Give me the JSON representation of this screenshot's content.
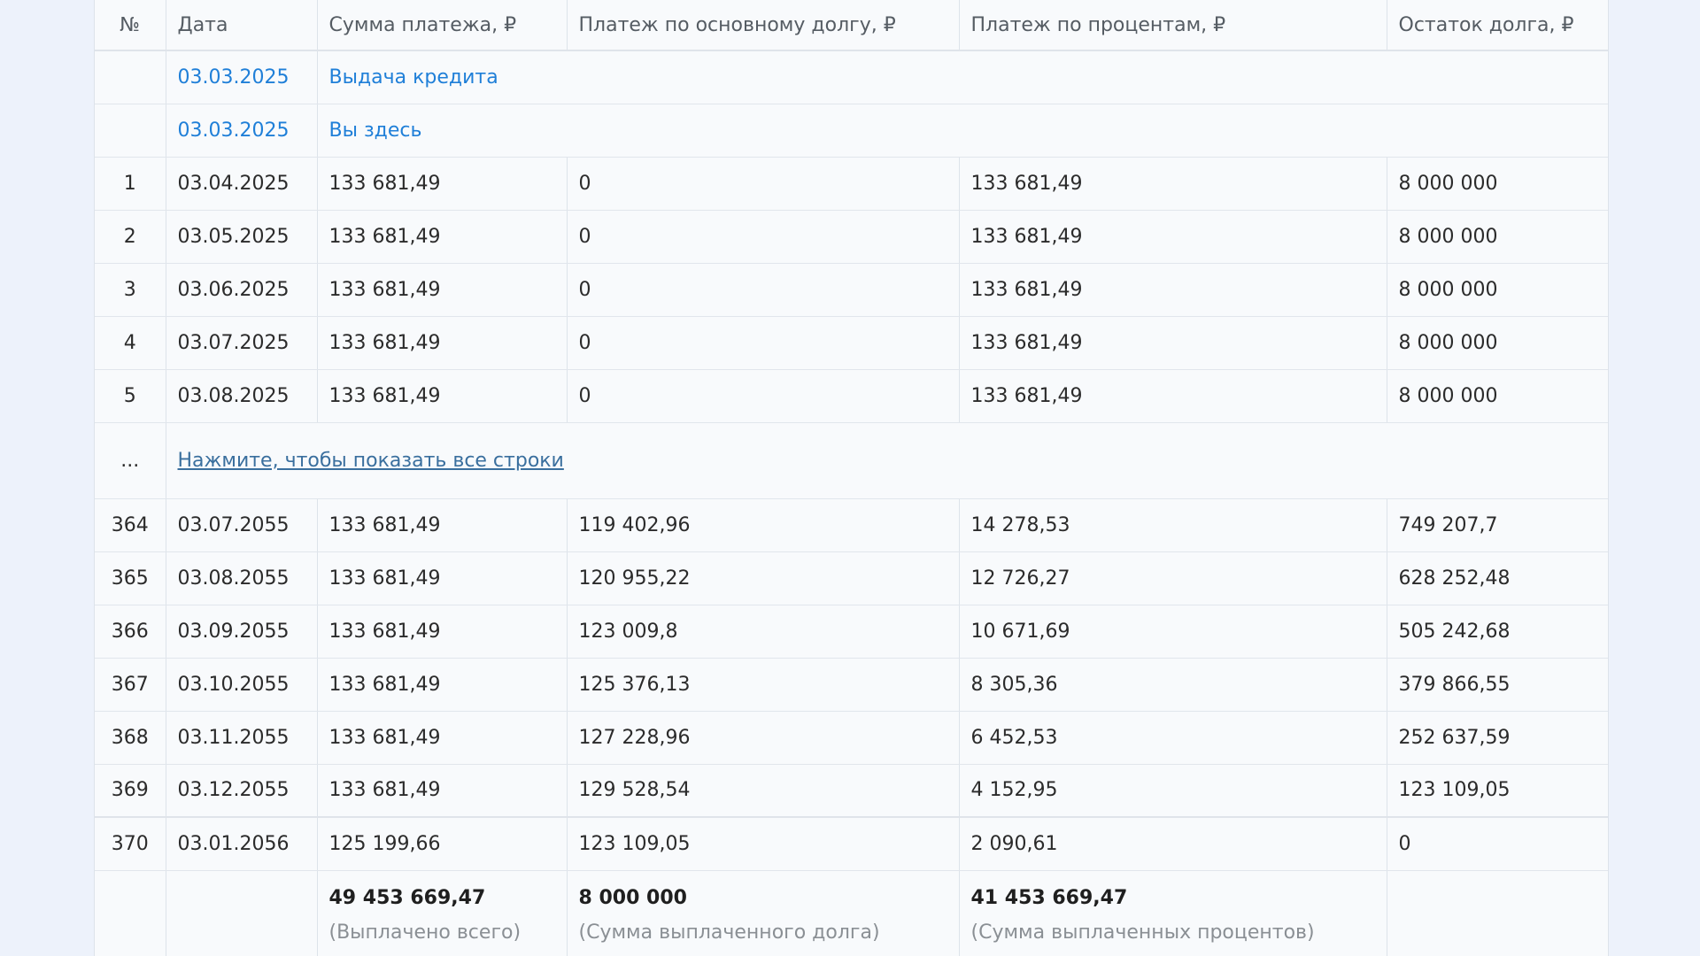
{
  "headers": [
    "№",
    "Дата",
    "Сумма платежа, ₽",
    "Платеж по основному долгу, ₽",
    "Платеж по процентам, ₽",
    "Остаток долга, ₽"
  ],
  "events": [
    {
      "date": "03.03.2025",
      "label": "Выдача кредита"
    },
    {
      "date": "03.03.2025",
      "label": "Вы здесь"
    }
  ],
  "rows_top": [
    [
      "1",
      "03.04.2025",
      "133 681,49",
      "0",
      "133 681,49",
      "8 000 000"
    ],
    [
      "2",
      "03.05.2025",
      "133 681,49",
      "0",
      "133 681,49",
      "8 000 000"
    ],
    [
      "3",
      "03.06.2025",
      "133 681,49",
      "0",
      "133 681,49",
      "8 000 000"
    ],
    [
      "4",
      "03.07.2025",
      "133 681,49",
      "0",
      "133 681,49",
      "8 000 000"
    ],
    [
      "5",
      "03.08.2025",
      "133 681,49",
      "0",
      "133 681,49",
      "8 000 000"
    ]
  ],
  "show_more": {
    "ellipsis": "...",
    "label": "Нажмите, чтобы показать все строки"
  },
  "rows_bottom": [
    [
      "364",
      "03.07.2055",
      "133 681,49",
      "119 402,96",
      "14 278,53",
      "749 207,7"
    ],
    [
      "365",
      "03.08.2055",
      "133 681,49",
      "120 955,22",
      "12 726,27",
      "628 252,48"
    ],
    [
      "366",
      "03.09.2055",
      "133 681,49",
      "123 009,8",
      "10 671,69",
      "505 242,68"
    ],
    [
      "367",
      "03.10.2055",
      "133 681,49",
      "125 376,13",
      "8 305,36",
      "379 866,55"
    ],
    [
      "368",
      "03.11.2055",
      "133 681,49",
      "127 228,96",
      "6 452,53",
      "252 637,59"
    ],
    [
      "369",
      "03.12.2055",
      "133 681,49",
      "129 528,54",
      "4 152,95",
      "123 109,05"
    ],
    [
      "370",
      "03.01.2056",
      "125 199,66",
      "123 109,05",
      "2 090,61",
      "0"
    ]
  ],
  "totals": [
    {
      "value": "49 453 669,47",
      "note": "(Выплачено всего)"
    },
    {
      "value": "8 000 000",
      "note": "(Сумма выплаченного долга)"
    },
    {
      "value": "41 453 669,47",
      "note": "(Сумма выплаченных процентов)"
    }
  ],
  "colors": {
    "link_blue": "#1f7fd8",
    "show_more_link": "#3a6f9e",
    "page_bg": "#edf2fb",
    "table_bg": "#f8fafc"
  }
}
